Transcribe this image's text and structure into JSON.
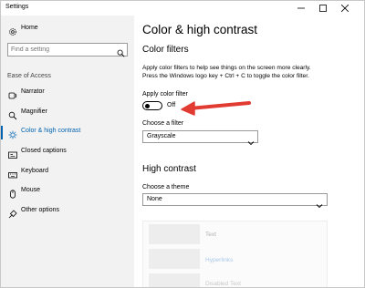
{
  "window": {
    "title": "Settings",
    "controls": {
      "minimize": "minimize",
      "maximize": "maximize",
      "close": "close"
    }
  },
  "sidebar": {
    "home_label": "Home",
    "search_placeholder": "Find a setting",
    "section_label": "Ease of Access",
    "items": [
      {
        "label": "Narrator",
        "icon": "narrator-icon"
      },
      {
        "label": "Magnifier",
        "icon": "magnifier-icon"
      },
      {
        "label": "Color & high contrast",
        "icon": "color-brightness-icon",
        "active": true
      },
      {
        "label": "Closed captions",
        "icon": "closed-captions-icon"
      },
      {
        "label": "Keyboard",
        "icon": "keyboard-icon"
      },
      {
        "label": "Mouse",
        "icon": "mouse-icon"
      },
      {
        "label": "Other options",
        "icon": "other-options-icon"
      }
    ]
  },
  "main": {
    "title": "Color & high contrast",
    "color_filters": {
      "heading": "Color filters",
      "description_line1": "Apply color filters to help see things on the screen more clearly.",
      "description_line2": "Press the Windows logo key + Ctrl + C to toggle the color filter.",
      "apply_label": "Apply color filter",
      "toggle_state": "Off",
      "toggle_on": false,
      "filter_label": "Choose a filter",
      "filter_value": "Grayscale"
    },
    "high_contrast": {
      "heading": "High contrast",
      "theme_label": "Choose a theme",
      "theme_value": "None",
      "preview": {
        "text": "Text",
        "hyperlinks": "Hyperlinks",
        "disabled_text": "Disabled Text"
      }
    }
  },
  "colors": {
    "accent": "#0063b1",
    "sidebar_bg": "#f2f2f2",
    "annotation_arrow": "#e23b32"
  }
}
